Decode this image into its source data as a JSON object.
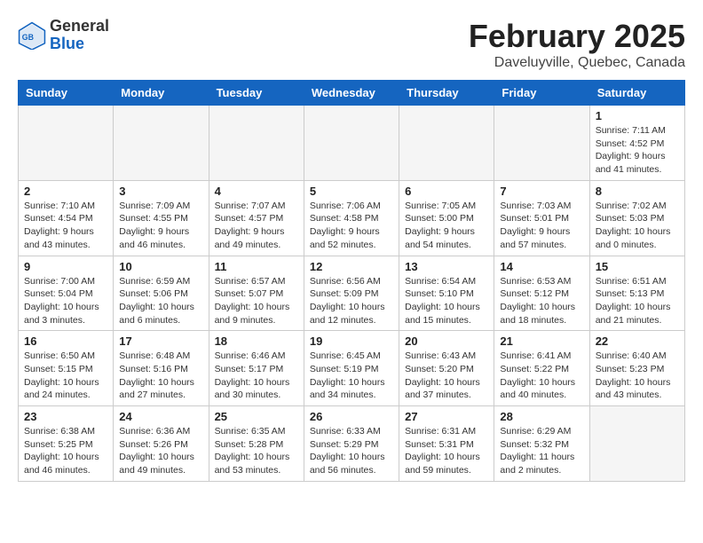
{
  "header": {
    "logo_general": "General",
    "logo_blue": "Blue",
    "month": "February 2025",
    "location": "Daveluyville, Quebec, Canada"
  },
  "weekdays": [
    "Sunday",
    "Monday",
    "Tuesday",
    "Wednesday",
    "Thursday",
    "Friday",
    "Saturday"
  ],
  "weeks": [
    [
      {
        "day": "",
        "info": ""
      },
      {
        "day": "",
        "info": ""
      },
      {
        "day": "",
        "info": ""
      },
      {
        "day": "",
        "info": ""
      },
      {
        "day": "",
        "info": ""
      },
      {
        "day": "",
        "info": ""
      },
      {
        "day": "1",
        "info": "Sunrise: 7:11 AM\nSunset: 4:52 PM\nDaylight: 9 hours\nand 41 minutes."
      }
    ],
    [
      {
        "day": "2",
        "info": "Sunrise: 7:10 AM\nSunset: 4:54 PM\nDaylight: 9 hours\nand 43 minutes."
      },
      {
        "day": "3",
        "info": "Sunrise: 7:09 AM\nSunset: 4:55 PM\nDaylight: 9 hours\nand 46 minutes."
      },
      {
        "day": "4",
        "info": "Sunrise: 7:07 AM\nSunset: 4:57 PM\nDaylight: 9 hours\nand 49 minutes."
      },
      {
        "day": "5",
        "info": "Sunrise: 7:06 AM\nSunset: 4:58 PM\nDaylight: 9 hours\nand 52 minutes."
      },
      {
        "day": "6",
        "info": "Sunrise: 7:05 AM\nSunset: 5:00 PM\nDaylight: 9 hours\nand 54 minutes."
      },
      {
        "day": "7",
        "info": "Sunrise: 7:03 AM\nSunset: 5:01 PM\nDaylight: 9 hours\nand 57 minutes."
      },
      {
        "day": "8",
        "info": "Sunrise: 7:02 AM\nSunset: 5:03 PM\nDaylight: 10 hours\nand 0 minutes."
      }
    ],
    [
      {
        "day": "9",
        "info": "Sunrise: 7:00 AM\nSunset: 5:04 PM\nDaylight: 10 hours\nand 3 minutes."
      },
      {
        "day": "10",
        "info": "Sunrise: 6:59 AM\nSunset: 5:06 PM\nDaylight: 10 hours\nand 6 minutes."
      },
      {
        "day": "11",
        "info": "Sunrise: 6:57 AM\nSunset: 5:07 PM\nDaylight: 10 hours\nand 9 minutes."
      },
      {
        "day": "12",
        "info": "Sunrise: 6:56 AM\nSunset: 5:09 PM\nDaylight: 10 hours\nand 12 minutes."
      },
      {
        "day": "13",
        "info": "Sunrise: 6:54 AM\nSunset: 5:10 PM\nDaylight: 10 hours\nand 15 minutes."
      },
      {
        "day": "14",
        "info": "Sunrise: 6:53 AM\nSunset: 5:12 PM\nDaylight: 10 hours\nand 18 minutes."
      },
      {
        "day": "15",
        "info": "Sunrise: 6:51 AM\nSunset: 5:13 PM\nDaylight: 10 hours\nand 21 minutes."
      }
    ],
    [
      {
        "day": "16",
        "info": "Sunrise: 6:50 AM\nSunset: 5:15 PM\nDaylight: 10 hours\nand 24 minutes."
      },
      {
        "day": "17",
        "info": "Sunrise: 6:48 AM\nSunset: 5:16 PM\nDaylight: 10 hours\nand 27 minutes."
      },
      {
        "day": "18",
        "info": "Sunrise: 6:46 AM\nSunset: 5:17 PM\nDaylight: 10 hours\nand 30 minutes."
      },
      {
        "day": "19",
        "info": "Sunrise: 6:45 AM\nSunset: 5:19 PM\nDaylight: 10 hours\nand 34 minutes."
      },
      {
        "day": "20",
        "info": "Sunrise: 6:43 AM\nSunset: 5:20 PM\nDaylight: 10 hours\nand 37 minutes."
      },
      {
        "day": "21",
        "info": "Sunrise: 6:41 AM\nSunset: 5:22 PM\nDaylight: 10 hours\nand 40 minutes."
      },
      {
        "day": "22",
        "info": "Sunrise: 6:40 AM\nSunset: 5:23 PM\nDaylight: 10 hours\nand 43 minutes."
      }
    ],
    [
      {
        "day": "23",
        "info": "Sunrise: 6:38 AM\nSunset: 5:25 PM\nDaylight: 10 hours\nand 46 minutes."
      },
      {
        "day": "24",
        "info": "Sunrise: 6:36 AM\nSunset: 5:26 PM\nDaylight: 10 hours\nand 49 minutes."
      },
      {
        "day": "25",
        "info": "Sunrise: 6:35 AM\nSunset: 5:28 PM\nDaylight: 10 hours\nand 53 minutes."
      },
      {
        "day": "26",
        "info": "Sunrise: 6:33 AM\nSunset: 5:29 PM\nDaylight: 10 hours\nand 56 minutes."
      },
      {
        "day": "27",
        "info": "Sunrise: 6:31 AM\nSunset: 5:31 PM\nDaylight: 10 hours\nand 59 minutes."
      },
      {
        "day": "28",
        "info": "Sunrise: 6:29 AM\nSunset: 5:32 PM\nDaylight: 11 hours\nand 2 minutes."
      },
      {
        "day": "",
        "info": ""
      }
    ]
  ]
}
